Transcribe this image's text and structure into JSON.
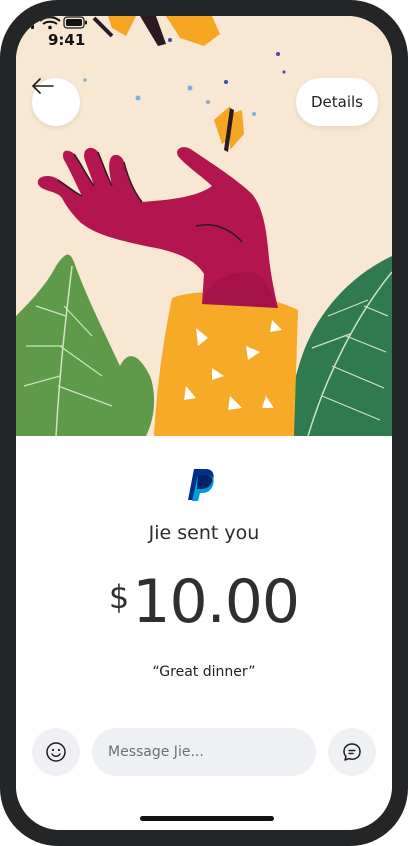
{
  "status_bar": {
    "time": "9:41",
    "icons": [
      "signal-icon",
      "wifi-icon",
      "battery-icon"
    ]
  },
  "header": {
    "back_icon": "arrow-left-icon",
    "details_label": "Details"
  },
  "payment": {
    "brand_icon": "paypal-logo",
    "sender_text": "Jie sent you",
    "currency_symbol": "$",
    "amount": "10.00",
    "note": "“Great dinner”"
  },
  "composer": {
    "emoji_icon": "smiley-icon",
    "placeholder": "Message Jie...",
    "chat_icon": "chat-bubble-icon"
  },
  "colors": {
    "hero_bg": "#f8e7d2",
    "hand": "#b3154f",
    "sleeve": "#f7a928",
    "leaf_light": "#5f9a4a",
    "leaf_dark": "#2f7a4f",
    "butterfly": "#f5a623",
    "paypal_dark": "#003087",
    "paypal_light": "#009cde",
    "frame": "#242526",
    "input_bg": "#eef0f4"
  }
}
